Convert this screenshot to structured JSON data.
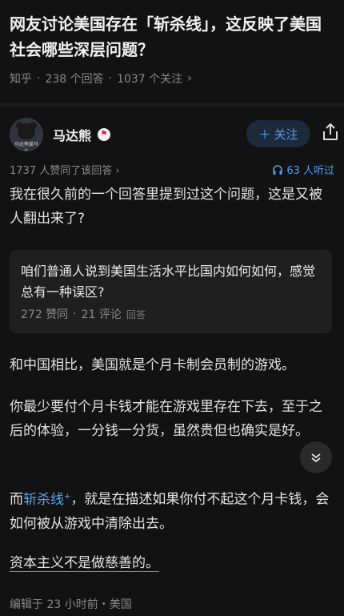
{
  "question": {
    "title": "网友讨论美国存在「斩杀线」，这反映了美国社会哪些深层问题？",
    "source": "知乎",
    "answers": "238 个回答",
    "followers": "1037 个关注"
  },
  "author": {
    "name": "马达熊",
    "avatar_caption": "马达熊爱马仕",
    "follow_label": "关注"
  },
  "stats": {
    "likes_text": "1737 人赞同了该回答",
    "listeners_text": "63 人听过"
  },
  "content": {
    "p1": "我在很久前的一个回答里提到过这个问题，这是又被人翻出来了?",
    "card": {
      "title": "咱们普通人说到美国生活水平比国内如何如何，感觉总有一种误区?",
      "likes": "272 赞同",
      "comments": "21 评论",
      "tag": "回答"
    },
    "p2": "和中国相比，美国就是个月卡制会员制的游戏。",
    "p3": "你最少要付个月卡钱才能在游戏里存在下去，至于之后的体验，一分钱一分货，虽然贵但也确实是好。",
    "p4_prefix": "而",
    "p4_link": "斩杀线",
    "p4_suffix": "，就是在描述如果你付不起这个月卡钱，会如何被从游戏中清除出去。",
    "p5": "资本主义不是做慈善的。"
  },
  "footer": {
    "edited": "编辑于 23 小时前・美国"
  },
  "colors": {
    "background": "#121212",
    "accent": "#4e9ff5",
    "card": "#1f1f1f"
  },
  "icons": [
    "chevron-right-icon",
    "plus-icon",
    "share-icon",
    "headphones-icon",
    "chevron-down-icon"
  ]
}
